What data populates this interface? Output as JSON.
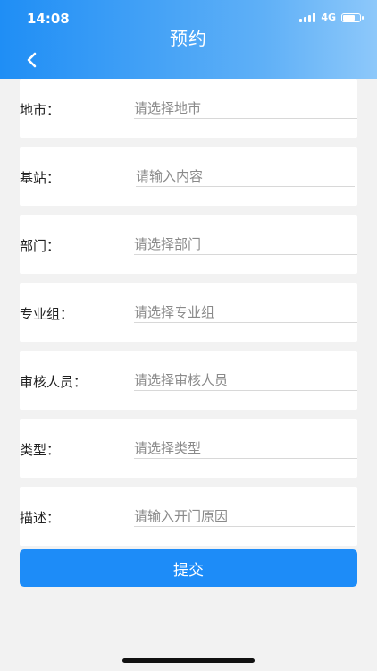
{
  "status_bar": {
    "time": "14:08",
    "network": "4G",
    "battery_level": 0.8
  },
  "header": {
    "title": "预约",
    "back_icon": "chevron-left-icon"
  },
  "form": {
    "rows": [
      {
        "label": "地市：",
        "placeholder": "请选择地市",
        "kind": "select"
      },
      {
        "label": "基站：",
        "placeholder": "请输入内容",
        "kind": "input"
      },
      {
        "label": "部门：",
        "placeholder": "请选择部门",
        "kind": "select"
      },
      {
        "label": "专业组：",
        "placeholder": "请选择专业组",
        "kind": "select"
      },
      {
        "label": "审核人员：",
        "placeholder": "请选择审核人员",
        "kind": "select"
      },
      {
        "label": "类型：",
        "placeholder": "请选择类型",
        "kind": "select"
      },
      {
        "label": "描述：",
        "placeholder": "请输入开门原因",
        "kind": "input"
      }
    ]
  },
  "actions": {
    "submit_label": "提交"
  },
  "colors": {
    "header_start": "#1f8ef5",
    "header_end": "#8dc8fa",
    "primary": "#1d8cf8",
    "page_bg": "#f2f2f2"
  }
}
